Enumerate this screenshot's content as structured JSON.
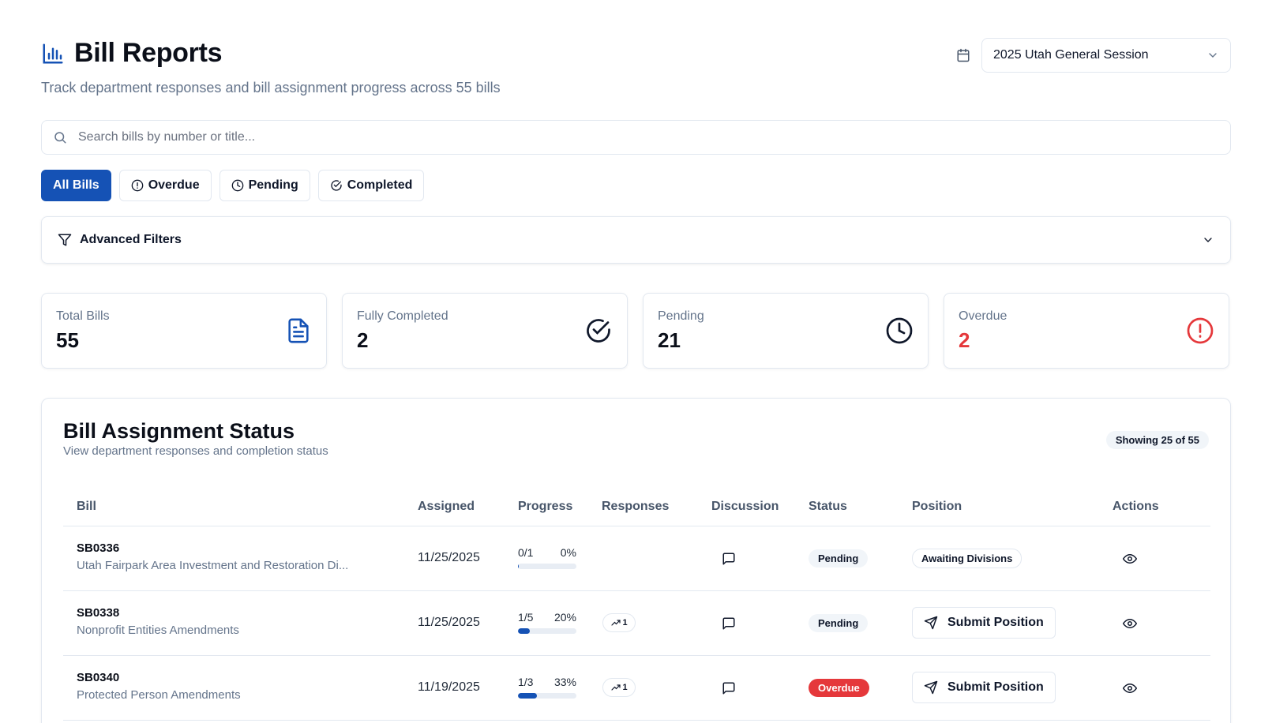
{
  "header": {
    "title": "Bill Reports",
    "subtitle": "Track department responses and bill assignment progress across 55 bills",
    "icon": "bar-chart-icon"
  },
  "session": {
    "selected": "2025 Utah General Session",
    "icon": "calendar-icon"
  },
  "search": {
    "placeholder": "Search bills by number or title...",
    "value": ""
  },
  "filters": [
    {
      "label": "All Bills",
      "active": true,
      "icon": ""
    },
    {
      "label": "Overdue",
      "active": false,
      "icon": "alert-circle-icon"
    },
    {
      "label": "Pending",
      "active": false,
      "icon": "clock-icon"
    },
    {
      "label": "Completed",
      "active": false,
      "icon": "check-circle-icon"
    }
  ],
  "advanced_filters": {
    "label": "Advanced Filters"
  },
  "stats": [
    {
      "label": "Total Bills",
      "value": "55",
      "icon": "file-text-icon",
      "color": "#1552b5"
    },
    {
      "label": "Fully Completed",
      "value": "2",
      "icon": "check-circle-icon",
      "color": "#0f172a"
    },
    {
      "label": "Pending",
      "value": "21",
      "icon": "clock-icon",
      "color": "#0f172a"
    },
    {
      "label": "Overdue",
      "value": "2",
      "icon": "alert-circle-icon",
      "color": "#e5383b"
    }
  ],
  "panel": {
    "title": "Bill Assignment Status",
    "subtitle": "View department responses and completion status",
    "showing": "Showing 25 of 55"
  },
  "table": {
    "columns": [
      "Bill",
      "Assigned",
      "Progress",
      "Responses",
      "Discussion",
      "Status",
      "Position",
      "Actions"
    ],
    "rows": [
      {
        "bill": "SB0336",
        "title": "Utah Fairpark Area Investment and Restoration Di...",
        "assigned": "11/25/2025",
        "progress": "0/1",
        "percent": "0%",
        "fraction": 0,
        "responses": "",
        "status": "Pending",
        "position": "Awaiting Divisions"
      },
      {
        "bill": "SB0338",
        "title": "Nonprofit Entities Amendments",
        "assigned": "11/25/2025",
        "progress": "1/5",
        "percent": "20%",
        "fraction": 0.2,
        "responses": "1",
        "status": "Pending",
        "position": "Submit Position"
      },
      {
        "bill": "SB0340",
        "title": "Protected Person Amendments",
        "assigned": "11/19/2025",
        "progress": "1/3",
        "percent": "33%",
        "fraction": 0.33,
        "responses": "1",
        "status": "Overdue",
        "position": "Submit Position"
      }
    ]
  },
  "colors": {
    "accent": "#1552b5",
    "danger": "#e5383b",
    "muted": "#64748b"
  }
}
